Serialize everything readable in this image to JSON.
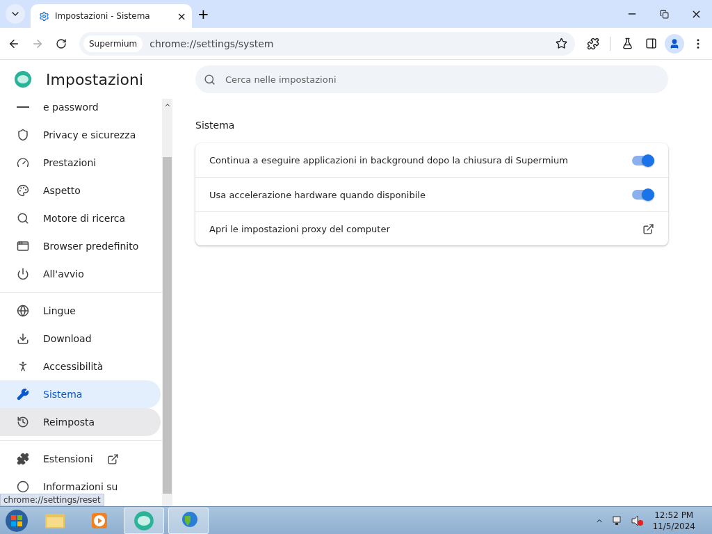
{
  "tab": {
    "title": "Impostazioni - Sistema",
    "close": "×"
  },
  "new_tab": "+",
  "omnibox": {
    "chip": "Supermium",
    "url": "chrome://settings/system"
  },
  "header": {
    "title": "Impostazioni"
  },
  "search": {
    "placeholder": "Cerca nelle impostazioni"
  },
  "sidebar": {
    "groups": [
      [
        {
          "label": "e password",
          "selected": false,
          "hovered": false
        },
        {
          "label": "Privacy e sicurezza",
          "selected": false,
          "hovered": false
        },
        {
          "label": "Prestazioni",
          "selected": false,
          "hovered": false
        },
        {
          "label": "Aspetto",
          "selected": false,
          "hovered": false
        },
        {
          "label": "Motore di ricerca",
          "selected": false,
          "hovered": false
        },
        {
          "label": "Browser predefinito",
          "selected": false,
          "hovered": false
        },
        {
          "label": "All'avvio",
          "selected": false,
          "hovered": false
        }
      ],
      [
        {
          "label": "Lingue",
          "selected": false,
          "hovered": false
        },
        {
          "label": "Download",
          "selected": false,
          "hovered": false
        },
        {
          "label": "Accessibilità",
          "selected": false,
          "hovered": false
        },
        {
          "label": "Sistema",
          "selected": true,
          "hovered": false
        },
        {
          "label": "Reimposta",
          "selected": false,
          "hovered": true
        }
      ],
      [
        {
          "label": "Estensioni",
          "selected": false,
          "hovered": false,
          "external": true
        },
        {
          "label": "Informazioni su",
          "selected": false,
          "hovered": false
        }
      ]
    ]
  },
  "section": {
    "title": "Sistema",
    "rows": [
      {
        "kind": "toggle",
        "label": "Continua a eseguire applicazioni in background dopo la chiusura di Supermium",
        "on": true
      },
      {
        "kind": "toggle",
        "label": "Usa accelerazione hardware quando disponibile",
        "on": true
      },
      {
        "kind": "link",
        "label": "Apri le impostazioni proxy del computer"
      }
    ]
  },
  "status_url": "chrome://settings/reset",
  "taskbar": {
    "apps": [
      {
        "active": false
      },
      {
        "active": false
      },
      {
        "active": true
      },
      {
        "active": true
      }
    ],
    "time": "12:52 PM",
    "date": "11/5/2024"
  }
}
